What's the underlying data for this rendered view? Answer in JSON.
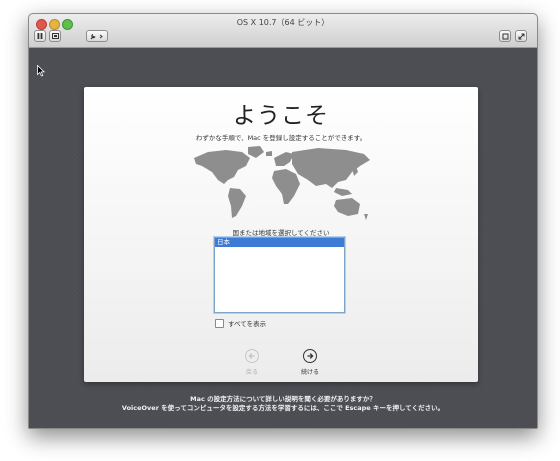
{
  "window": {
    "title": "OS X 10.7（64 ビット）"
  },
  "panel": {
    "welcome": "ようこそ",
    "subtitle": "わずかな手順で、Mac を登録し設定することができます。",
    "region_label": "国または地域を選択してください",
    "regions": [
      "日本"
    ],
    "show_all_label": "すべてを表示",
    "back_label": "戻る",
    "continue_label": "続ける"
  },
  "footer": {
    "line1": "Mac の設定方法について詳しい説明を聞く必要がありますか？",
    "line2": "VoiceOver を使ってコンピュータを設定する方法を学習するには、ここで Escape キーを押してください。"
  },
  "icons": {
    "close": "close-icon",
    "minimize": "minimize-icon",
    "zoom": "zoom-icon",
    "pause": "pause-icon",
    "screenshot": "screenshot-icon",
    "settings": "wrench-icon",
    "fullscreen": "fullscreen-icon",
    "world_map": "world-map-icon"
  },
  "colors": {
    "selection": "#3d7bd6",
    "background": "#4b4d53"
  }
}
